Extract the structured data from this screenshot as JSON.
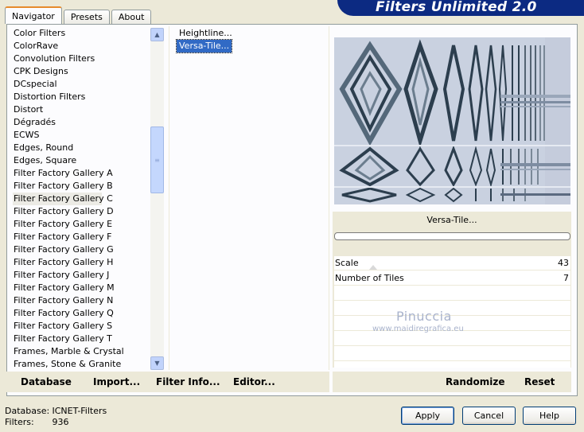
{
  "tabs": [
    {
      "label": "Navigator",
      "active": true
    },
    {
      "label": "Presets",
      "active": false
    },
    {
      "label": "About",
      "active": false
    }
  ],
  "header": {
    "title": "Filters Unlimited 2.0"
  },
  "categories": {
    "items": [
      "Color Filters",
      "ColorRave",
      "Convolution Filters",
      "CPK Designs",
      "DCspecial",
      "Distortion Filters",
      "Distort",
      "Dégradés",
      "ECWS",
      "Edges, Round",
      "Edges, Square",
      "Filter Factory Gallery A",
      "Filter Factory Gallery B",
      "Filter Factory Gallery C",
      "Filter Factory Gallery D",
      "Filter Factory Gallery E",
      "Filter Factory Gallery F",
      "Filter Factory Gallery G",
      "Filter Factory Gallery H",
      "Filter Factory Gallery J",
      "Filter Factory Gallery M",
      "Filter Factory Gallery N",
      "Filter Factory Gallery Q",
      "Filter Factory Gallery S",
      "Filter Factory Gallery T",
      "Frames, Marble & Crystal",
      "Frames, Stone & Granite"
    ],
    "selected_index": 13
  },
  "filters": {
    "items": [
      "Heightline...",
      "Versa-Tile..."
    ],
    "selected_index": 1
  },
  "preview": {
    "filter_name": "Versa-Tile..."
  },
  "params": [
    {
      "label": "Scale",
      "value": "43"
    },
    {
      "label": "Number of Tiles",
      "value": "7"
    }
  ],
  "watermark": {
    "name": "Pinuccia",
    "url": "www.maidiregrafica.eu"
  },
  "toolbar": {
    "database": "Database",
    "import": "Import...",
    "filter_info": "Filter Info...",
    "editor": "Editor...",
    "randomize": "Randomize",
    "reset": "Reset"
  },
  "status": {
    "database_label": "Database:",
    "database_value": "ICNET-Filters",
    "filters_label": "Filters:",
    "filters_value": "936"
  },
  "buttons": {
    "apply": "Apply",
    "cancel": "Cancel",
    "help": "Help"
  },
  "colors": {
    "selection": "#316ac5",
    "header_bg": "#0c2a82",
    "dialog_bg": "#ece9d8"
  }
}
